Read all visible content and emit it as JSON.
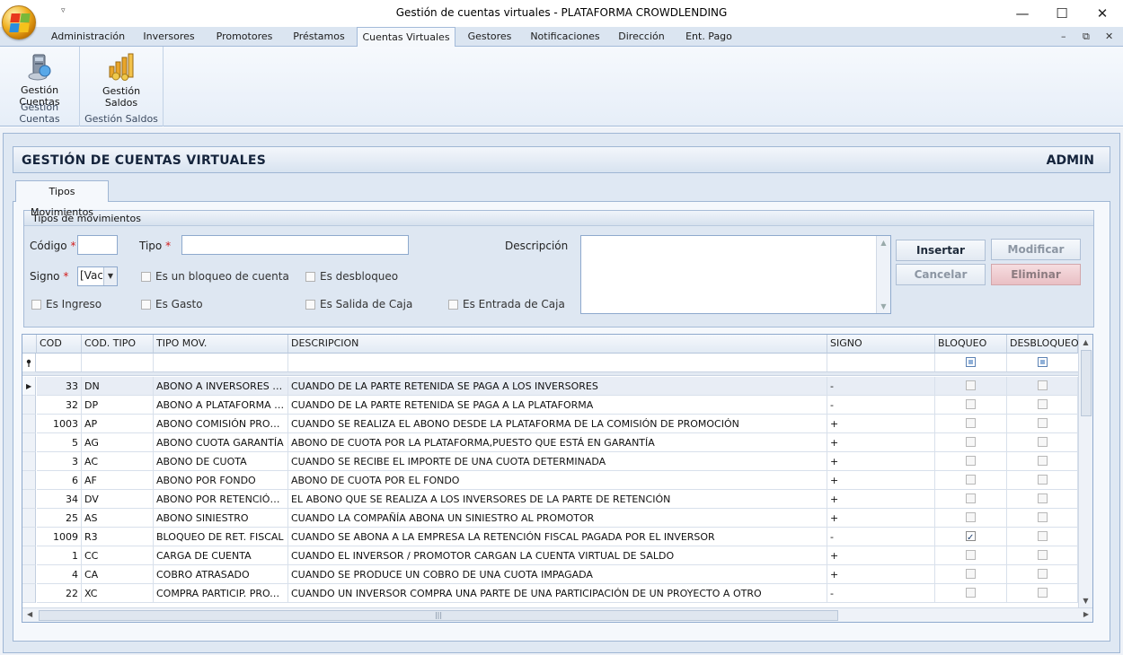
{
  "window": {
    "title": "Gestión de cuentas virtuales - PLATAFORMA CROWDLENDING"
  },
  "ribbon_tabs": [
    "Administración",
    "Inversores",
    "Promotores",
    "Préstamos",
    "Cuentas Virtuales",
    "Gestores",
    "Notificaciones",
    "Dirección",
    "Ent. Pago"
  ],
  "ribbon_active_tab": "Cuentas Virtuales",
  "ribbon": {
    "btn_cuentas": "Gestión Cuentas",
    "group_cuentas": "Gestión Cuentas",
    "btn_saldos": "Gestión Saldos",
    "group_saldos": "Gestión Saldos"
  },
  "header": {
    "title": "GESTIÓN DE CUENTAS VIRTUALES",
    "user": "ADMIN"
  },
  "tab": {
    "label": "Tipos Movimientos"
  },
  "form": {
    "group_title": "Tipos de movimientos",
    "codigo_label": "Código",
    "tipo_label": "Tipo",
    "descripcion_label": "Descripción",
    "signo_label": "Signo",
    "required_mark": "*",
    "signo_value": "[Vac",
    "codigo_value": "",
    "tipo_value": "",
    "descripcion_value": "",
    "cb_bloqueo": "Es un bloqueo de cuenta",
    "cb_desbloqueo": "Es desbloqueo",
    "cb_ingreso": "Es Ingreso",
    "cb_gasto": "Es Gasto",
    "cb_salida": "Es Salida de Caja",
    "cb_entrada": "Es Entrada de Caja"
  },
  "buttons": {
    "insertar": "Insertar",
    "modificar": "Modificar",
    "cancelar": "Cancelar",
    "eliminar": "Eliminar"
  },
  "grid": {
    "columns": [
      "COD",
      "COD. TIPO",
      "TIPO MOV.",
      "DESCRIPCION",
      "SIGNO",
      "BLOQUEO",
      "DESBLOQUEO"
    ],
    "rows": [
      {
        "cod": "33",
        "codtipo": "DN",
        "tipo": "ABONO A INVERSORES (GAR)",
        "desc": "CUANDO DE LA PARTE RETENIDA SE PAGA A LOS INVERSORES",
        "signo": "-",
        "bloqueo": false,
        "desbloqueo": false
      },
      {
        "cod": "32",
        "codtipo": "DP",
        "tipo": "ABONO A PLATAFORMA (GAR)",
        "desc": "CUANDO DE LA PARTE RETENIDA SE PAGA A LA PLATAFORMA",
        "signo": "-",
        "bloqueo": false,
        "desbloqueo": false
      },
      {
        "cod": "1003",
        "codtipo": "AP",
        "tipo": "ABONO COMISIÓN PROMOCIÓN",
        "desc": "CUANDO SE REALIZA EL ABONO DESDE LA PLATAFORMA DE LA COMISIÓN DE PROMOCIÓN",
        "signo": "+",
        "bloqueo": false,
        "desbloqueo": false
      },
      {
        "cod": "5",
        "codtipo": "AG",
        "tipo": "ABONO CUOTA GARANTÍA",
        "desc": "ABONO DE CUOTA POR LA PLATAFORMA,PUESTO QUE ESTÁ EN GARANTÍA",
        "signo": "+",
        "bloqueo": false,
        "desbloqueo": false
      },
      {
        "cod": "3",
        "codtipo": "AC",
        "tipo": "ABONO DE CUOTA",
        "desc": "CUANDO SE RECIBE EL IMPORTE DE UNA CUOTA DETERMINADA",
        "signo": "+",
        "bloqueo": false,
        "desbloqueo": false
      },
      {
        "cod": "6",
        "codtipo": "AF",
        "tipo": "ABONO POR FONDO",
        "desc": "ABONO DE CUOTA POR EL FONDO",
        "signo": "+",
        "bloqueo": false,
        "desbloqueo": false
      },
      {
        "cod": "34",
        "codtipo": "DV",
        "tipo": "ABONO POR RETENCIÓN (GAR)",
        "desc": "EL ABONO QUE SE REALIZA A LOS INVERSORES DE LA PARTE DE RETENCIÓN",
        "signo": "+",
        "bloqueo": false,
        "desbloqueo": false
      },
      {
        "cod": "25",
        "codtipo": "AS",
        "tipo": "ABONO SINIESTRO",
        "desc": "CUANDO LA COMPAÑÍA ABONA UN SINIESTRO AL PROMOTOR",
        "signo": "+",
        "bloqueo": false,
        "desbloqueo": false
      },
      {
        "cod": "1009",
        "codtipo": "R3",
        "tipo": "BLOQUEO DE RET. FISCAL",
        "desc": "CUANDO SE ABONA A LA EMPRESA LA RETENCIÓN FISCAL PAGADA POR EL INVERSOR",
        "signo": "-",
        "bloqueo": true,
        "desbloqueo": false
      },
      {
        "cod": "1",
        "codtipo": "CC",
        "tipo": "CARGA DE CUENTA",
        "desc": "CUANDO EL INVERSOR / PROMOTOR CARGAN LA CUENTA VIRTUAL DE SALDO",
        "signo": "+",
        "bloqueo": false,
        "desbloqueo": false
      },
      {
        "cod": "4",
        "codtipo": "CA",
        "tipo": "COBRO ATRASADO",
        "desc": "CUANDO SE PRODUCE UN COBRO DE UNA CUOTA IMPAGADA",
        "signo": "+",
        "bloqueo": false,
        "desbloqueo": false
      },
      {
        "cod": "22",
        "codtipo": "XC",
        "tipo": "COMPRA PARTICIP. PROYECTO",
        "desc": "CUANDO UN INVERSOR COMPRA UNA PARTE DE UNA PARTICIPACIÓN DE UN PROYECTO A OTRO",
        "signo": "-",
        "bloqueo": false,
        "desbloqueo": false
      }
    ]
  },
  "colors": {
    "ribbon_bg": "#dbe5f1",
    "panel_bg": "#dfe8f3",
    "border": "#9fb6d4",
    "header_text": "#15243c",
    "required": "#d21c1c"
  }
}
